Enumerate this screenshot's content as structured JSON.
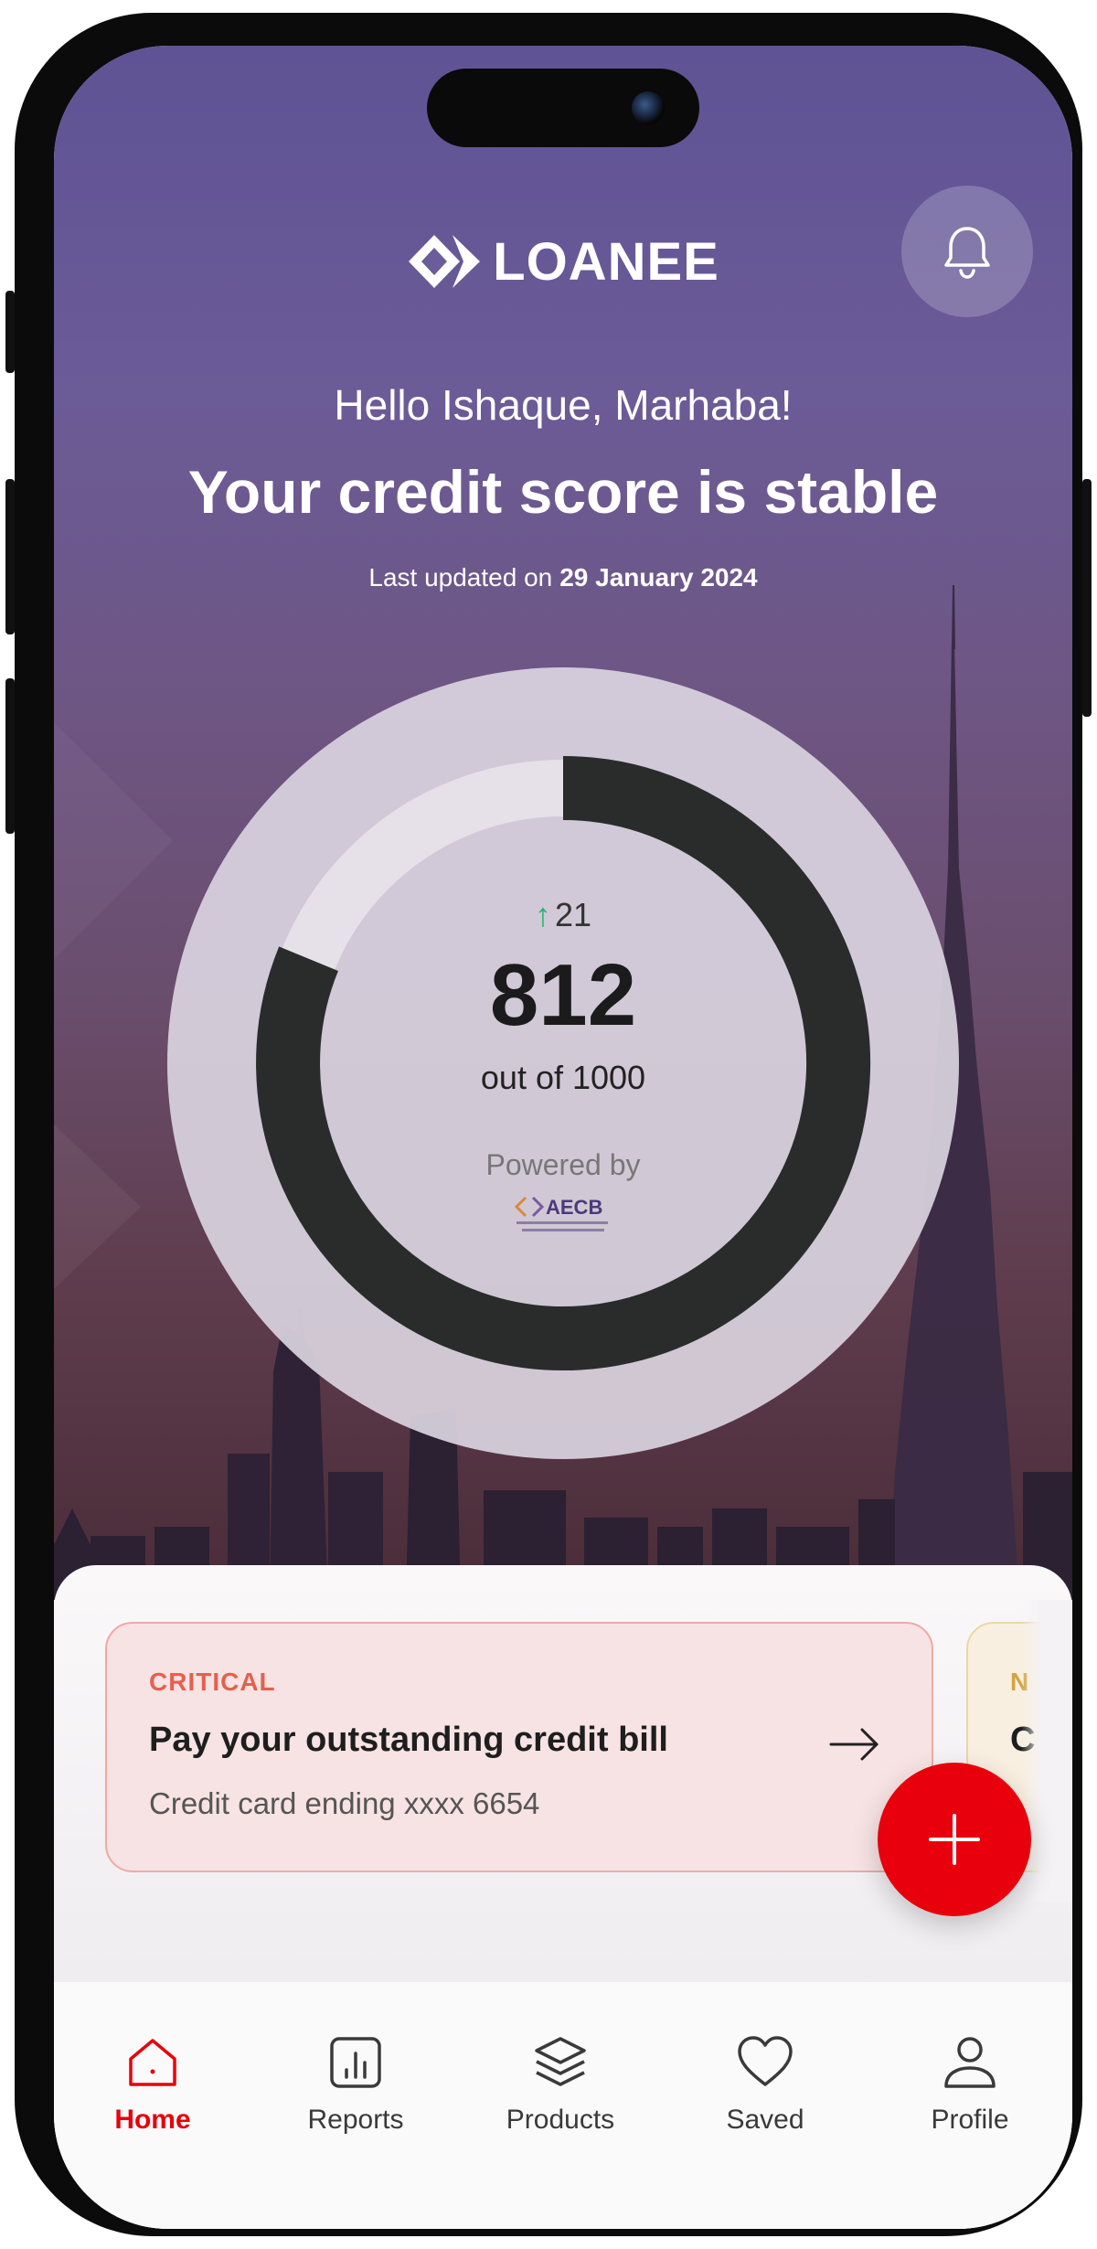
{
  "app": {
    "brand": "LOANEE",
    "icons": {
      "logo": "diamond-logo-icon",
      "notifications": "bell-icon"
    }
  },
  "hero": {
    "greeting": "Hello Ishaque, Marhaba!",
    "headline": "Your credit score is stable",
    "updated_label": "Last updated on",
    "updated_date": "29 January 2024"
  },
  "score": {
    "delta": "21",
    "delta_direction": "up",
    "value": "812",
    "max_label": "out of 1000",
    "fill_fraction": 0.812,
    "powered_by": "Powered by",
    "provider_logo": "AECB",
    "colors": {
      "arc": "#2a2c2c",
      "track": "#e6e1e9",
      "delta_up": "#22b573"
    }
  },
  "alerts": [
    {
      "tag": "CRITICAL",
      "title": "Pay your outstanding credit bill",
      "subtitle": "Credit card ending xxxx 6654",
      "color": "#e5604f"
    },
    {
      "tag": "N",
      "title": "C",
      "color": "#d3a442"
    }
  ],
  "fab": {
    "icon": "plus-icon",
    "color": "#e8000c"
  },
  "nav": {
    "items": [
      {
        "label": "Home",
        "icon": "home-icon",
        "active": true
      },
      {
        "label": "Reports",
        "icon": "bar-chart-icon",
        "active": false
      },
      {
        "label": "Products",
        "icon": "layers-icon",
        "active": false
      },
      {
        "label": "Saved",
        "icon": "heart-icon",
        "active": false
      },
      {
        "label": "Profile",
        "icon": "user-icon",
        "active": false
      }
    ],
    "active_color": "#e8000c"
  }
}
